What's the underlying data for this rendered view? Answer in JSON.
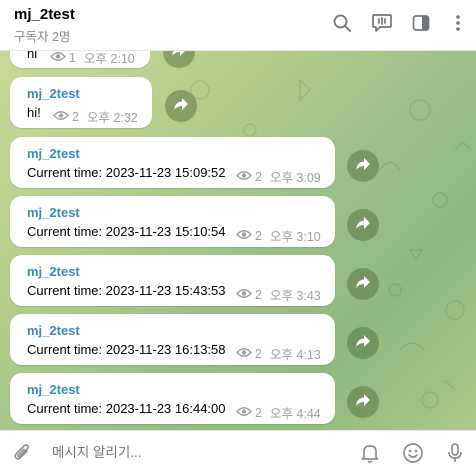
{
  "header": {
    "title": "mj_2test",
    "subtitle": "구독자 2명"
  },
  "messages": [
    {
      "name": "",
      "text": "hi",
      "views": "1",
      "time": "오후 2:10"
    },
    {
      "name": "mj_2test",
      "text": "hi!",
      "views": "2",
      "time": "오후 2:32"
    },
    {
      "name": "mj_2test",
      "text": "Current time: 2023-11-23 15:09:52",
      "views": "2",
      "time": "오후 3:09"
    },
    {
      "name": "mj_2test",
      "text": "Current time: 2023-11-23 15:10:54",
      "views": "2",
      "time": "오후 3:10"
    },
    {
      "name": "mj_2test",
      "text": "Current time: 2023-11-23 15:43:53",
      "views": "2",
      "time": "오후 3:43"
    },
    {
      "name": "mj_2test",
      "text": "Current time: 2023-11-23 16:13:58",
      "views": "2",
      "time": "오후 4:13"
    },
    {
      "name": "mj_2test",
      "text": "Current time: 2023-11-23 16:44:00",
      "views": "2",
      "time": "오후 4:44"
    }
  ],
  "composer": {
    "placeholder": "메시지 알리기..."
  },
  "icons": {
    "header": [
      "search-icon",
      "live-chat-icon",
      "sidebar-toggle-icon",
      "more-icon"
    ],
    "composer": [
      "attach-icon",
      "bell-icon",
      "emoji-icon",
      "microphone-icon"
    ],
    "forward": "forward-icon",
    "views": "eye-icon"
  },
  "colors": {
    "sender_name": "#3a8cbf",
    "meta_text": "#9aa39a",
    "icon_gray": "#707579"
  }
}
